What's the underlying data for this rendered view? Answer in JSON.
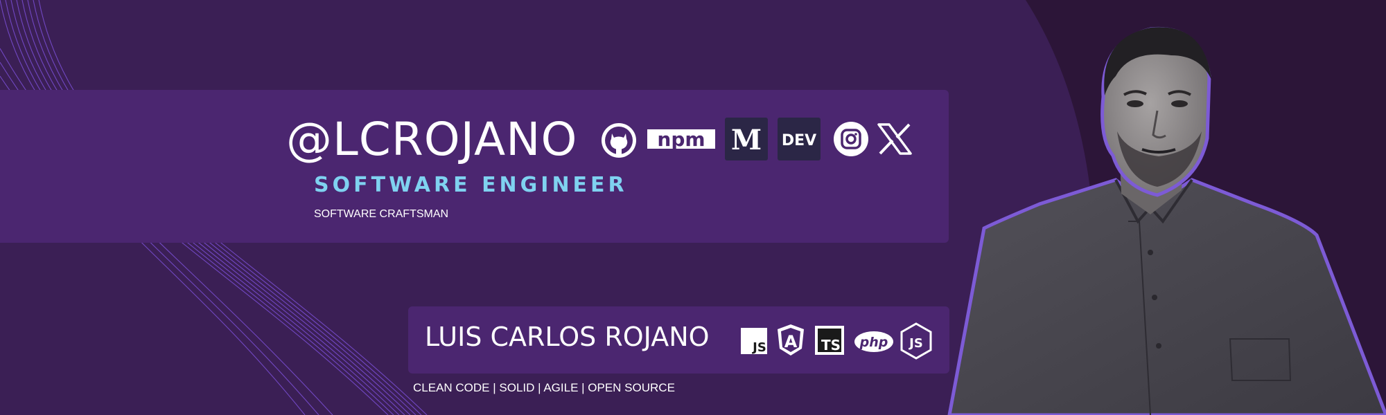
{
  "header": {
    "handle": "@LCROJANO",
    "role": "SOFTWARE ENGINEER",
    "subrole": "SOFTWARE CRAFTSMAN"
  },
  "social_links": [
    {
      "icon": "github-icon"
    },
    {
      "icon": "npm-icon",
      "label": "npm"
    },
    {
      "icon": "medium-icon",
      "label": "M"
    },
    {
      "icon": "dev-icon",
      "label": "DEV"
    },
    {
      "icon": "instagram-icon"
    },
    {
      "icon": "x-icon"
    }
  ],
  "footer": {
    "name": "LUIS CARLOS ROJANO",
    "principles": "CLEAN CODE | SOLID | AGILE | OPEN SOURCE"
  },
  "tech_stack": [
    {
      "icon": "javascript-icon",
      "label": "JS"
    },
    {
      "icon": "angular-icon",
      "label": "A"
    },
    {
      "icon": "typescript-icon",
      "label": "TS"
    },
    {
      "icon": "php-icon",
      "label": "php"
    },
    {
      "icon": "nodejs-icon",
      "label": "JS"
    }
  ],
  "colors": {
    "background": "#2c1538",
    "panel": "#3b1f55",
    "card": "#4b2670",
    "accent": "#7fd2f0",
    "wave": "#7b4fd6",
    "outline": "#7d5bd6"
  }
}
